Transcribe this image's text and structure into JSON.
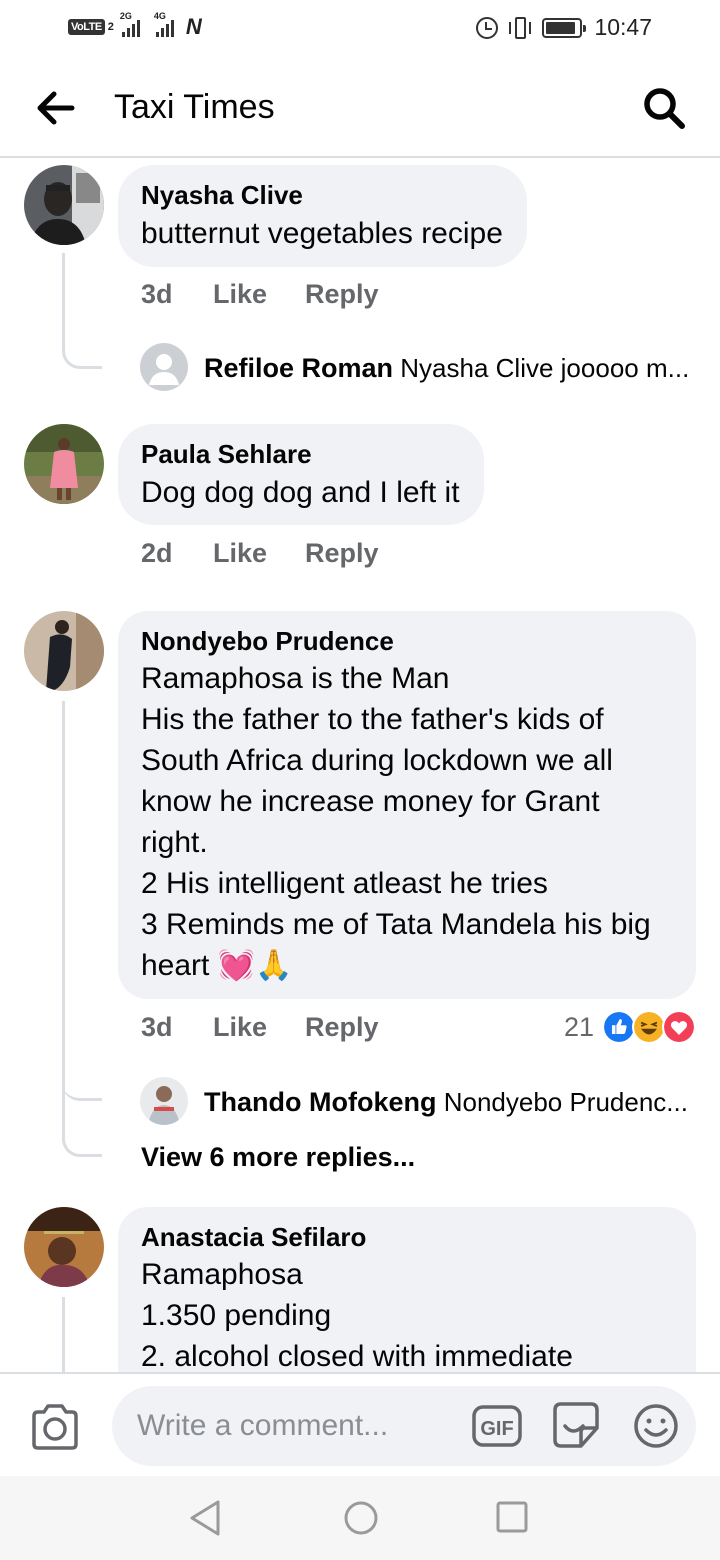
{
  "status_bar": {
    "volte": "VoLTE",
    "sim": "2",
    "net1": "2G",
    "net2": "4G",
    "time": "10:47",
    "battery_level": 0.9
  },
  "header": {
    "title": "Taxi Times",
    "back_icon": "arrow-left-icon",
    "search_icon": "search-icon"
  },
  "comments": [
    {
      "author": "Nyasha Clive",
      "text": "butternut vegetables recipe",
      "age": "3d",
      "like": "Like",
      "reply": "Reply",
      "replies_preview": [
        {
          "author": "Refiloe Roman",
          "text": "Nyasha Clive jooooo m..."
        }
      ]
    },
    {
      "author": "Paula Sehlare",
      "text": "Dog dog dog and I left it",
      "age": "2d",
      "like": "Like",
      "reply": "Reply"
    },
    {
      "author": "Nondyebo Prudence",
      "text": "Ramaphosa is the Man\nHis the father to the father's kids of South Africa during lockdown we all know he increase money for Grant right.\n2 His intelligent atleast he tries\n3 Reminds me of Tata Mandela his big heart 💓🙏",
      "age": "3d",
      "like": "Like",
      "reply": "Reply",
      "reaction_count": "21",
      "reactions": [
        "like",
        "haha",
        "love"
      ],
      "replies_preview": [
        {
          "author": "Thando Mofokeng",
          "text": "Nondyebo Prudenc..."
        }
      ],
      "more_replies": "View 6 more replies..."
    },
    {
      "author": "Anastacia Sefilaro",
      "text": "Ramaphosa\n1.350 pending\n2. alcohol closed with immediate"
    }
  ],
  "composer": {
    "placeholder": "Write a comment...",
    "gif_label": "GIF"
  },
  "colors": {
    "bubble": "#f0f2f5",
    "secondary_text": "#65676b",
    "like_blue": "#1877f2",
    "love_red": "#f33e58",
    "haha_yellow": "#f7b125"
  }
}
